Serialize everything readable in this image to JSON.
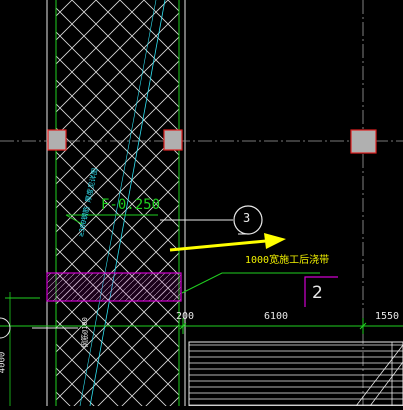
{
  "drawing": {
    "elevation_tag": "F-0.250",
    "callout_number": "3",
    "pour_strip_note": "1000宽施工后浇带",
    "section_mark": "2",
    "dimensions": [
      "200",
      "6100",
      "1550"
    ],
    "left_dim_text": "4000",
    "rotated_note": "≥300钢筋 厚度见详图",
    "rotated_left_note": "钢筋@100",
    "colors": {
      "background": "#000000",
      "wall_outline": "#20d020",
      "hatch": "#e8e8e8",
      "column_fill": "#b0b0b0",
      "column_outline": "#e02020",
      "arrow": "#ffff00",
      "pour_strip": "#d000d0",
      "leader": "#30e0f0",
      "axis_line": "#a0a0a0"
    }
  }
}
